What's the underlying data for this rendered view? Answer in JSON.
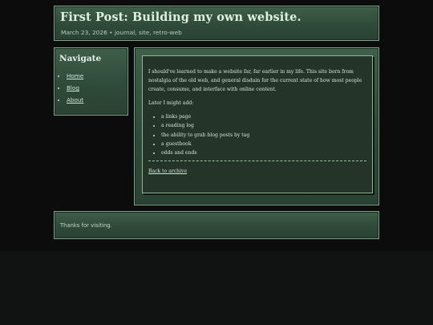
{
  "header": {
    "title": "First Post: Building my own website.",
    "meta": "March 23, 2026 • journal, site, retro-web"
  },
  "nav": {
    "title": "Navigate",
    "items": [
      {
        "label": "Home"
      },
      {
        "label": "Blog"
      },
      {
        "label": "About"
      }
    ]
  },
  "post": {
    "intro": "I should've learned to make a website far, far earlier in my life. This site born from nostalgia of the old web, and general disdain for the current state of how most people create, consume, and interface with online content.",
    "later_heading": "Later I might add:",
    "items": [
      "a links page",
      "a reading log",
      "the ability to grab blog posts by tag",
      "a guestbook",
      "odds and ends"
    ],
    "back_link": "Back to archive"
  },
  "footer": {
    "text": "Thanks for visiting."
  },
  "colors": {
    "panel": "#3f5f4a",
    "panel_border": "#7fa58a",
    "page_bg": "#0b0c0b",
    "text": "#d6e6d6"
  }
}
